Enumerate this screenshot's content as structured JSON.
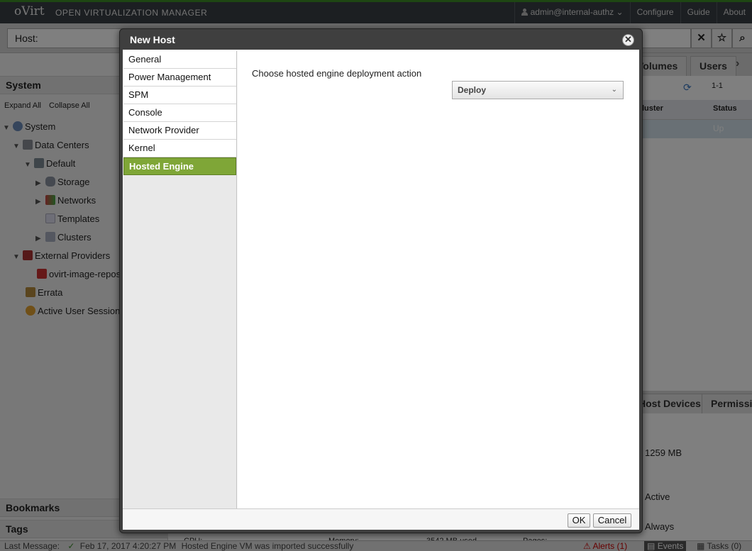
{
  "app": {
    "brand": "oVirt",
    "product": "OPEN VIRTUALIZATION MANAGER",
    "topnav": {
      "user": "admin@internal-authz",
      "configure": "Configure",
      "guide": "Guide",
      "about": "About"
    }
  },
  "search": {
    "value": "Host:"
  },
  "left": {
    "header": "System",
    "expand_all": "Expand All",
    "collapse_all": "Collapse All",
    "tree": {
      "system": "System",
      "data_centers": "Data Centers",
      "default": "Default",
      "storage": "Storage",
      "networks": "Networks",
      "templates": "Templates",
      "clusters": "Clusters",
      "external_providers": "External Providers",
      "ovirt_image_repo": "ovirt-image-repos",
      "errata": "Errata",
      "active_sessions": "Active User Sessions"
    },
    "bookmarks": "Bookmarks",
    "tags": "Tags"
  },
  "right": {
    "tabs": {
      "volumes": "Volumes",
      "users": "Users"
    },
    "paging": "1-1",
    "grid": {
      "col_cluster": "Cluster",
      "col_status": "Status",
      "row_status": "Up"
    },
    "detail_tabs": {
      "host_devices": "Host Devices",
      "permissions": "Permissions"
    },
    "details": {
      "memory_free": "1259 MB",
      "status": "Active",
      "policy": "Always",
      "cpu": "CPU:",
      "memory": "Memory:",
      "memory_used": "3542 MB used",
      "pages": "Pages:"
    }
  },
  "status": {
    "last_message": "Last Message:",
    "timestamp": "Feb 17, 2017 4:20:27 PM",
    "message": "Hosted Engine VM was imported successfully",
    "alerts": "Alerts (1)",
    "events": "Events",
    "tasks": "Tasks (0)"
  },
  "dialog": {
    "title": "New Host",
    "nav": [
      "General",
      "Power Management",
      "SPM",
      "Console",
      "Network Provider",
      "Kernel",
      "Hosted Engine"
    ],
    "active_tab": "Hosted Engine",
    "question": "Choose hosted engine deployment action",
    "deploy_action": "Deploy",
    "ok": "OK",
    "cancel": "Cancel"
  },
  "colors": {
    "accent_green": "#7fa637",
    "header_dark": "#393f44",
    "overlay": "rgba(0,0,0,0.5)"
  }
}
